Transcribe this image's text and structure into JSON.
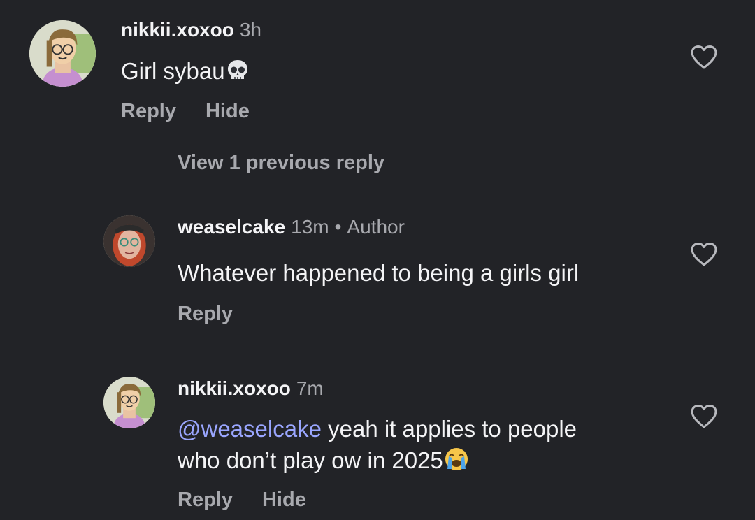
{
  "comments": [
    {
      "username": "nikkii.xoxoo",
      "time": "3h",
      "text": "Girl sybau",
      "emoji": "skull-emoji",
      "reply_label": "Reply",
      "hide_label": "Hide"
    },
    {
      "username": "weaselcake",
      "time": "13m",
      "badge": "Author",
      "text": "Whatever happened to being a girls girl",
      "reply_label": "Reply"
    },
    {
      "username": "nikkii.xoxoo",
      "time": "7m",
      "mention": "@weaselcake",
      "text_line1": "yeah it applies to people",
      "text_line2": "who don’t play ow in 2025",
      "emoji": "loudly-crying-emoji",
      "reply_label": "Reply",
      "hide_label": "Hide"
    }
  ],
  "view_replies_label": "View 1 previous reply",
  "icons": {
    "like": "heart-outline-icon"
  },
  "colors": {
    "background": "#222327",
    "text_primary": "#f4f4f6",
    "text_secondary": "#a8a9ae",
    "mention": "#9aa6ff"
  }
}
